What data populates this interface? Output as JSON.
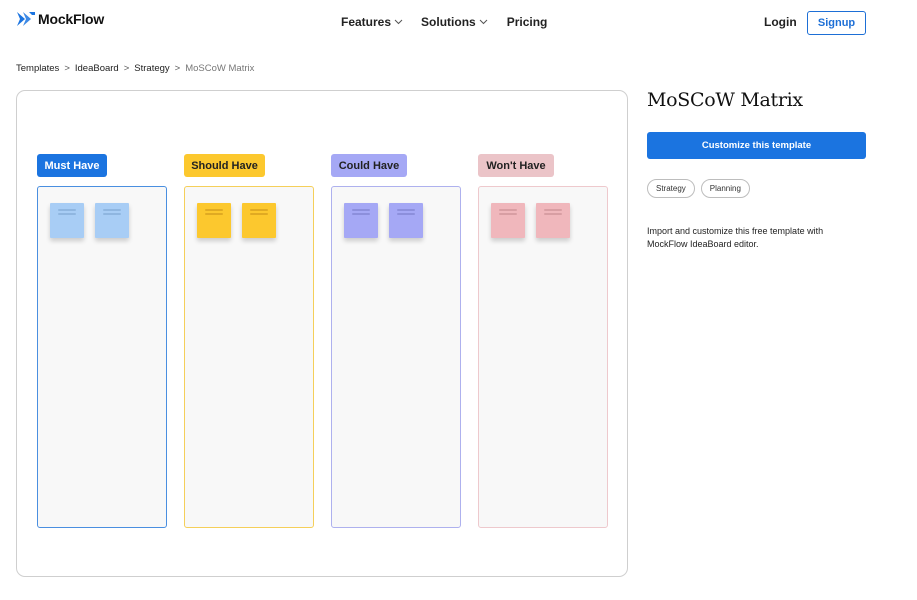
{
  "header": {
    "logo_text": "MockFlow",
    "nav": [
      {
        "label": "Features",
        "has_dropdown": true
      },
      {
        "label": "Solutions",
        "has_dropdown": true
      },
      {
        "label": "Pricing",
        "has_dropdown": false
      }
    ],
    "login_label": "Login",
    "signup_label": "Signup"
  },
  "breadcrumb": {
    "items": [
      "Templates",
      "IdeaBoard",
      "Strategy"
    ],
    "current": "MoSCoW Matrix",
    "separator": ">"
  },
  "board": {
    "columns": [
      {
        "label": "Must Have",
        "label_bg": "#1b74e0",
        "label_color": "#ffffff",
        "border": "#4a8fe0",
        "note_color": "#a8cdf5",
        "note_line": "#8fb6e0",
        "notes": 2
      },
      {
        "label": "Should Have",
        "label_bg": "#fcc82e",
        "label_color": "#222222",
        "border": "#f5cf5a",
        "note_color": "#fcc82e",
        "note_line": "#e0aa22",
        "notes": 2
      },
      {
        "label": "Could Have",
        "label_bg": "#a5a8f5",
        "label_color": "#222222",
        "border": "#aeb1ee",
        "note_color": "#a5a8f5",
        "note_line": "#8c8fdc",
        "notes": 2
      },
      {
        "label": "Won't Have",
        "label_bg": "#ebc4c8",
        "label_color": "#222222",
        "border": "#eec9cd",
        "note_color": "#f0b7bc",
        "note_line": "#d89ea3",
        "notes": 2
      }
    ]
  },
  "details": {
    "title": "MoSCoW Matrix",
    "cta_label": "Customize this template",
    "tags": [
      "Strategy",
      "Planning"
    ],
    "description": "Import and customize this free template with MockFlow IdeaBoard editor."
  },
  "colors": {
    "accent": "#1b74e0"
  }
}
